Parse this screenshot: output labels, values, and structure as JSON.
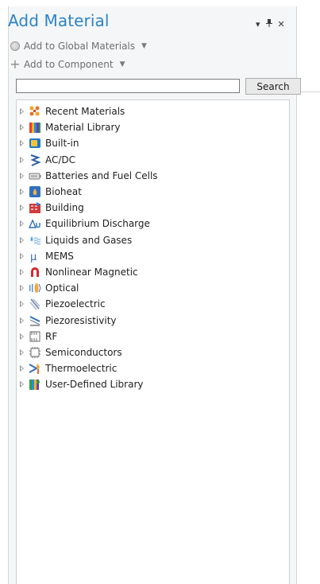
{
  "panel": {
    "title": "Add Material",
    "controls": {
      "menu_glyph": "▾",
      "pin_glyph": "⊥",
      "close_glyph": "✕"
    }
  },
  "actions": {
    "global": {
      "label": "Add to Global Materials",
      "icon": "globe-icon"
    },
    "component": {
      "label": "Add to Component",
      "icon": "plus-icon"
    }
  },
  "search": {
    "value": "",
    "placeholder": "",
    "button_label": "Search"
  },
  "tree": {
    "items": [
      {
        "label": "Recent Materials",
        "icon": "recent-materials-icon"
      },
      {
        "label": "Material Library",
        "icon": "material-library-icon"
      },
      {
        "label": "Built-in",
        "icon": "built-in-icon"
      },
      {
        "label": "AC/DC",
        "icon": "acdc-icon"
      },
      {
        "label": "Batteries and Fuel Cells",
        "icon": "battery-icon"
      },
      {
        "label": "Bioheat",
        "icon": "bioheat-icon"
      },
      {
        "label": "Building",
        "icon": "building-icon"
      },
      {
        "label": "Equilibrium Discharge",
        "icon": "equilibrium-discharge-icon"
      },
      {
        "label": "Liquids and Gases",
        "icon": "liquids-gases-icon"
      },
      {
        "label": "MEMS",
        "icon": "mems-icon"
      },
      {
        "label": "Nonlinear Magnetic",
        "icon": "magnet-icon"
      },
      {
        "label": "Optical",
        "icon": "optical-icon"
      },
      {
        "label": "Piezoelectric",
        "icon": "piezoelectric-icon"
      },
      {
        "label": "Piezoresistivity",
        "icon": "piezoresistivity-icon"
      },
      {
        "label": "RF",
        "icon": "rf-icon"
      },
      {
        "label": "Semiconductors",
        "icon": "semiconductor-icon"
      },
      {
        "label": "Thermoelectric",
        "icon": "thermoelectric-icon"
      },
      {
        "label": "User-Defined Library",
        "icon": "user-library-icon"
      }
    ]
  }
}
